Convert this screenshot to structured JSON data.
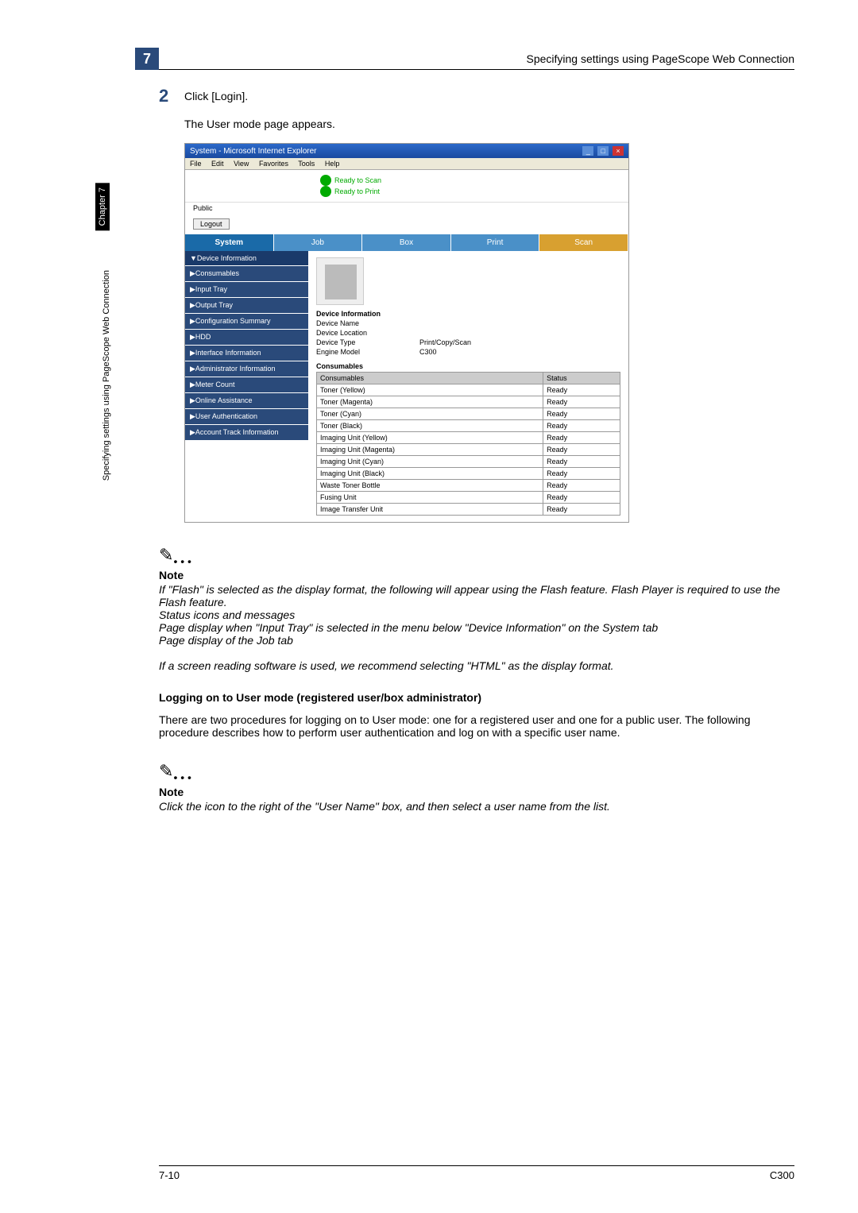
{
  "header": {
    "chapter_num": "7",
    "title": "Specifying settings using PageScope Web Connection"
  },
  "side": {
    "tab": "Chapter 7",
    "text": "Specifying settings using PageScope Web Connection"
  },
  "step": {
    "num": "2",
    "text": "Click [Login].",
    "result": "The User mode page appears."
  },
  "screenshot": {
    "titlebar": "System - Microsoft Internet Explorer",
    "menu": [
      "File",
      "Edit",
      "View",
      "Favorites",
      "Tools",
      "Help"
    ],
    "status": {
      "line1": "Ready to Scan",
      "line2": "Ready to Print"
    },
    "user_label": "Public",
    "logout": "Logout",
    "tabs": [
      "System",
      "Job",
      "Box",
      "Print",
      "Scan"
    ],
    "sidebar": [
      "▼Device Information",
      "▶Consumables",
      "▶Input Tray",
      "▶Output Tray",
      "▶Configuration Summary",
      "▶HDD",
      "▶Interface Information",
      "▶Administrator Information",
      "▶Meter Count",
      "▶Online Assistance",
      "▶User Authentication",
      "▶Account Track Information"
    ],
    "info_heading": "Device Information",
    "info_rows": [
      {
        "k": "Device Name",
        "v": ""
      },
      {
        "k": "Device Location",
        "v": ""
      },
      {
        "k": "Device Type",
        "v": "Print/Copy/Scan"
      },
      {
        "k": "Engine Model",
        "v": "C300"
      }
    ],
    "consumables_heading": "Consumables",
    "table_headers": [
      "Consumables",
      "Status"
    ],
    "table_rows": [
      [
        "Toner (Yellow)",
        "Ready"
      ],
      [
        "Toner (Magenta)",
        "Ready"
      ],
      [
        "Toner (Cyan)",
        "Ready"
      ],
      [
        "Toner (Black)",
        "Ready"
      ],
      [
        "Imaging Unit (Yellow)",
        "Ready"
      ],
      [
        "Imaging Unit (Magenta)",
        "Ready"
      ],
      [
        "Imaging Unit (Cyan)",
        "Ready"
      ],
      [
        "Imaging Unit (Black)",
        "Ready"
      ],
      [
        "Waste Toner Bottle",
        "Ready"
      ],
      [
        "Fusing Unit",
        "Ready"
      ],
      [
        "Image Transfer Unit",
        "Ready"
      ]
    ]
  },
  "note1": {
    "label": "Note",
    "p1": "If \"Flash\" is selected as the display format, the following will appear using the Flash feature. Flash Player is required to use the Flash feature.",
    "p2": "Status icons and messages",
    "p3": "Page display when \"Input Tray\" is selected in the menu below \"Device Information\" on the System tab",
    "p4": "Page display of the Job tab",
    "p5": "If a screen reading software is used, we recommend selecting \"HTML\" as the display format."
  },
  "section": {
    "title": "Logging on to User mode (registered user/box administrator)",
    "para": "There are two procedures for logging on to User mode: one for a registered user and one for a public user. The following procedure describes how to perform user authentication and log on with a specific user name."
  },
  "note2": {
    "label": "Note",
    "p1": "Click the icon to the right of the \"User Name\" box, and then select a user name from the list."
  },
  "footer": {
    "left": "7-10",
    "right": "C300"
  }
}
